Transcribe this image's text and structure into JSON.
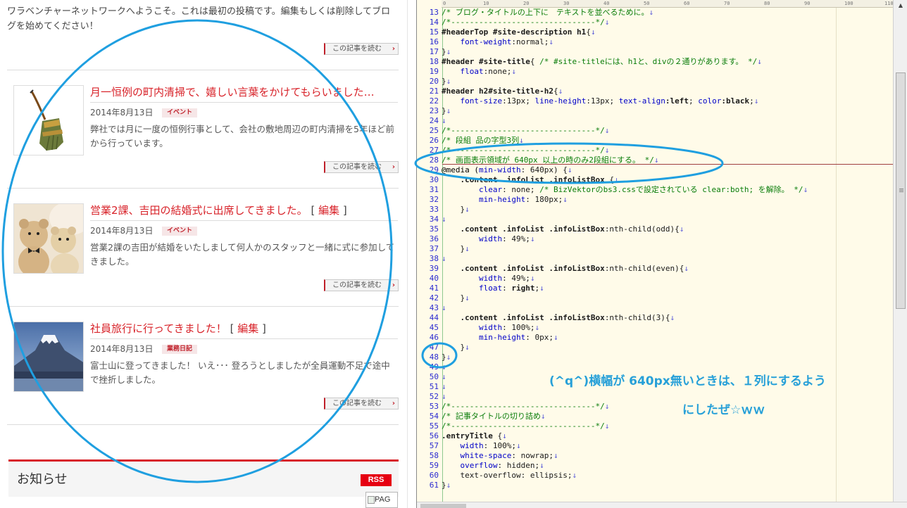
{
  "blog": {
    "intro": "ワラベンチャーネットワークへようこそ。これは最初の投稿です。編集もしくは削除してブログを始めてください！",
    "read_more_label": "この記事を読む",
    "posts": [
      {
        "title": "月一恒例の町内清掃で、嬉しい言葉をかけてもらいました…",
        "date": "2014年8月13日",
        "category": "イベント",
        "excerpt": "弊社では月に一度の恒例行事として、会社の敷地周辺の町内清掃を5年ほど前から行っています。",
        "thumb_icon": "broom-icon"
      },
      {
        "title": "営業2課、吉田の結婚式に出席してきました。",
        "edit": "編集",
        "date": "2014年8月13日",
        "category": "イベント",
        "excerpt": "営業2課の吉田が結婚をいたしまして何人かのスタッフと一緒に式に参加してきました。",
        "thumb_icon": "teddy-bears-photo"
      },
      {
        "title": "社員旅行に行ってきました！",
        "edit": "編集",
        "date": "2014年8月13日",
        "category": "業務日記",
        "excerpt": "富士山に登ってきました！ いえ･･･ 登ろうとしましたが全員運動不足で途中で挫折しました。",
        "thumb_icon": "mount-fuji-photo"
      }
    ],
    "notice_title": "お知らせ",
    "rss_label": "RSS",
    "broken_image_alt": "PAG"
  },
  "editor": {
    "ruler_marks": [
      "0",
      "10",
      "20",
      "30",
      "40",
      "50",
      "60",
      "70",
      "80",
      "90",
      "100",
      "110"
    ],
    "annotation_line1": "(^q^)横幅が 640px無いときは、１列にするよう",
    "annotation_line2": "にしたぜ☆ｗｗ",
    "lines": [
      {
        "n": "13",
        "parts": [
          [
            "k-comment",
            "/* ブログ・タイトルの上下に　テキストを並べるために。"
          ]
        ]
      },
      {
        "n": "14",
        "parts": [
          [
            "k-comment",
            "/*-------------------------------*/"
          ]
        ]
      },
      {
        "n": "15",
        "parts": [
          [
            "k-sel",
            "#headerTop #site-description h1"
          ],
          [
            "k-val",
            "{"
          ]
        ]
      },
      {
        "n": "16",
        "parts": [
          [
            "k-val",
            "    "
          ],
          [
            "k-prop",
            "font-weight"
          ],
          [
            "k-val",
            ":normal;"
          ]
        ]
      },
      {
        "n": "17",
        "parts": [
          [
            "k-val",
            "}"
          ]
        ]
      },
      {
        "n": "18",
        "parts": [
          [
            "k-sel",
            "#header #site-title"
          ],
          [
            "k-val",
            "{ "
          ],
          [
            "k-comment",
            "/* #site-titleには、h1と、divの２通りがあります。 */"
          ]
        ]
      },
      {
        "n": "19",
        "parts": [
          [
            "k-val",
            "    "
          ],
          [
            "k-prop",
            "float"
          ],
          [
            "k-val",
            ":none;"
          ]
        ]
      },
      {
        "n": "20",
        "parts": [
          [
            "k-val",
            "}"
          ]
        ]
      },
      {
        "n": "21",
        "parts": [
          [
            "k-sel",
            "#header h2#site-title-h2"
          ],
          [
            "k-val",
            "{"
          ]
        ]
      },
      {
        "n": "22",
        "parts": [
          [
            "k-val",
            "    "
          ],
          [
            "k-prop",
            "font-size"
          ],
          [
            "k-val",
            ":13px; "
          ],
          [
            "k-prop",
            "line-height"
          ],
          [
            "k-val",
            ":13px; "
          ],
          [
            "k-prop",
            "text-align"
          ],
          [
            "k-sel",
            ":left"
          ],
          [
            "k-val",
            "; "
          ],
          [
            "k-prop",
            "color"
          ],
          [
            "k-sel",
            ":black"
          ],
          [
            "k-val",
            ";"
          ]
        ]
      },
      {
        "n": "23",
        "parts": [
          [
            "k-val",
            "}"
          ]
        ]
      },
      {
        "n": "24",
        "parts": [
          [
            "k-val",
            ""
          ]
        ]
      },
      {
        "n": "25",
        "parts": [
          [
            "k-comment",
            "/*-------------------------------*/"
          ]
        ]
      },
      {
        "n": "26",
        "parts": [
          [
            "k-comment",
            "/* 段組 品の字型3列"
          ]
        ]
      },
      {
        "n": "27",
        "parts": [
          [
            "k-comment",
            "/*-------------------------------*/"
          ]
        ]
      },
      {
        "n": "28",
        "parts": [
          [
            "k-comment",
            "/* 画面表示領域が 640px 以上の時のみ2段組にする。 */"
          ]
        ]
      },
      {
        "n": "29",
        "parts": [
          [
            "k-at",
            "@media ("
          ],
          [
            "k-prop",
            "min-width"
          ],
          [
            "k-val",
            ": 640px) {"
          ]
        ]
      },
      {
        "n": "30",
        "parts": [
          [
            "k-val",
            "    "
          ],
          [
            "k-sel",
            ".content .infoList .infoListBox"
          ],
          [
            "k-val",
            " {"
          ]
        ]
      },
      {
        "n": "31",
        "parts": [
          [
            "k-val",
            "        "
          ],
          [
            "k-prop",
            "clear"
          ],
          [
            "k-val",
            ": none; "
          ],
          [
            "k-comment",
            "/* BizVektorのbs3.cssで設定されている clear:both; を解除。 */"
          ]
        ]
      },
      {
        "n": "32",
        "parts": [
          [
            "k-val",
            "        "
          ],
          [
            "k-prop",
            "min-height"
          ],
          [
            "k-val",
            ": 180px;"
          ]
        ]
      },
      {
        "n": "33",
        "parts": [
          [
            "k-val",
            "    }"
          ]
        ]
      },
      {
        "n": "34",
        "parts": [
          [
            "k-val",
            ""
          ]
        ]
      },
      {
        "n": "35",
        "parts": [
          [
            "k-val",
            "    "
          ],
          [
            "k-sel",
            ".content .infoList .infoListBox"
          ],
          [
            "k-val",
            ":nth-child(odd){"
          ]
        ]
      },
      {
        "n": "36",
        "parts": [
          [
            "k-val",
            "        "
          ],
          [
            "k-prop",
            "width"
          ],
          [
            "k-val",
            ": 49%;"
          ]
        ]
      },
      {
        "n": "37",
        "parts": [
          [
            "k-val",
            "    }"
          ]
        ]
      },
      {
        "n": "38",
        "parts": [
          [
            "k-val",
            ""
          ]
        ]
      },
      {
        "n": "39",
        "parts": [
          [
            "k-val",
            "    "
          ],
          [
            "k-sel",
            ".content .infoList .infoListBox"
          ],
          [
            "k-val",
            ":nth-child(even){"
          ]
        ]
      },
      {
        "n": "40",
        "parts": [
          [
            "k-val",
            "        "
          ],
          [
            "k-prop",
            "width"
          ],
          [
            "k-val",
            ": 49%;"
          ]
        ]
      },
      {
        "n": "41",
        "parts": [
          [
            "k-val",
            "        "
          ],
          [
            "k-prop",
            "float"
          ],
          [
            "k-val",
            ": "
          ],
          [
            "k-sel",
            "right"
          ],
          [
            "k-val",
            ";"
          ]
        ]
      },
      {
        "n": "42",
        "parts": [
          [
            "k-val",
            "    }"
          ]
        ]
      },
      {
        "n": "43",
        "parts": [
          [
            "k-val",
            ""
          ]
        ]
      },
      {
        "n": "44",
        "parts": [
          [
            "k-val",
            "    "
          ],
          [
            "k-sel",
            ".content .infoList .infoListBox"
          ],
          [
            "k-val",
            ":nth-child(3){"
          ]
        ]
      },
      {
        "n": "45",
        "parts": [
          [
            "k-val",
            "        "
          ],
          [
            "k-prop",
            "width"
          ],
          [
            "k-val",
            ": 100%;"
          ]
        ]
      },
      {
        "n": "46",
        "parts": [
          [
            "k-val",
            "        "
          ],
          [
            "k-prop",
            "min-height"
          ],
          [
            "k-val",
            ": 0px;"
          ]
        ]
      },
      {
        "n": "47",
        "parts": [
          [
            "k-val",
            "    }"
          ]
        ]
      },
      {
        "n": "48",
        "parts": [
          [
            "k-val",
            "}"
          ]
        ]
      },
      {
        "n": "49",
        "parts": [
          [
            "k-val",
            ""
          ]
        ]
      },
      {
        "n": "50",
        "parts": [
          [
            "k-val",
            ""
          ]
        ]
      },
      {
        "n": "51",
        "parts": [
          [
            "k-val",
            ""
          ]
        ]
      },
      {
        "n": "52",
        "parts": [
          [
            "k-val",
            ""
          ]
        ]
      },
      {
        "n": "53",
        "parts": [
          [
            "k-comment",
            "/*-------------------------------*/"
          ]
        ]
      },
      {
        "n": "54",
        "parts": [
          [
            "k-comment",
            "/* 記事タイトルの切り詰め"
          ]
        ]
      },
      {
        "n": "55",
        "parts": [
          [
            "k-comment",
            "/*-------------------------------*/"
          ]
        ]
      },
      {
        "n": "56",
        "parts": [
          [
            "k-sel",
            ".entryTitle"
          ],
          [
            "k-val",
            " {"
          ]
        ]
      },
      {
        "n": "57",
        "parts": [
          [
            "k-val",
            "    "
          ],
          [
            "k-prop",
            "width"
          ],
          [
            "k-val",
            ": 100%;"
          ]
        ]
      },
      {
        "n": "58",
        "parts": [
          [
            "k-val",
            "    "
          ],
          [
            "k-prop",
            "white-space"
          ],
          [
            "k-val",
            ": nowrap;"
          ]
        ]
      },
      {
        "n": "59",
        "parts": [
          [
            "k-val",
            "    "
          ],
          [
            "k-prop",
            "overflow"
          ],
          [
            "k-val",
            ": hidden;"
          ]
        ]
      },
      {
        "n": "60",
        "parts": [
          [
            "k-val",
            "    "
          ],
          [
            "k-val",
            "text-overflow: ellipsis;"
          ]
        ]
      },
      {
        "n": "61",
        "parts": [
          [
            "k-val",
            "}"
          ]
        ]
      }
    ]
  },
  "colors": {
    "accent_red": "#d8232a",
    "annotation_blue": "#1f9fe0",
    "editor_bg": "#fffbe9"
  }
}
